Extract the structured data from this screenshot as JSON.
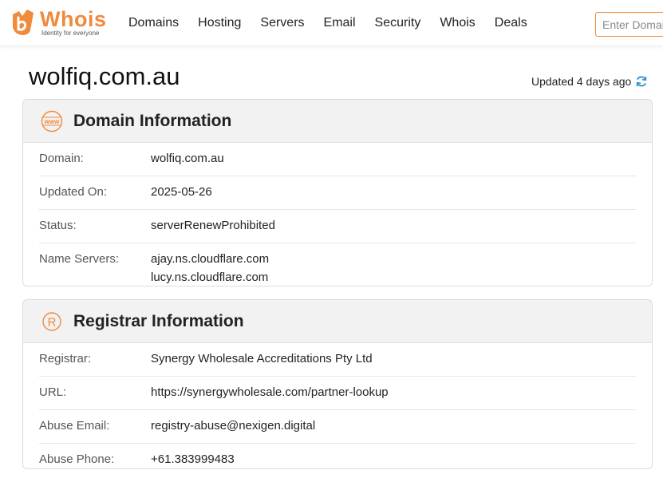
{
  "header": {
    "logo_text": "Whois",
    "logo_tagline": "Identity for everyone",
    "nav": [
      "Domains",
      "Hosting",
      "Servers",
      "Email",
      "Security",
      "Whois",
      "Deals"
    ],
    "search_placeholder": "Enter Domain or IP"
  },
  "page": {
    "title": "wolfiq.com.au",
    "updated_text": "Updated 4 days ago"
  },
  "domain_info": {
    "title": "Domain Information",
    "icon_text": "www",
    "rows": [
      {
        "label": "Domain:",
        "value": "wolfiq.com.au"
      },
      {
        "label": "Updated On:",
        "value": "2025-05-26"
      },
      {
        "label": "Status:",
        "value": "serverRenewProhibited"
      }
    ],
    "name_servers_label": "Name Servers:",
    "name_servers": [
      "ajay.ns.cloudflare.com",
      "lucy.ns.cloudflare.com"
    ]
  },
  "registrar_info": {
    "title": "Registrar Information",
    "icon_text": "R",
    "rows": [
      {
        "label": "Registrar:",
        "value": "Synergy Wholesale Accreditations Pty Ltd"
      },
      {
        "label": "URL:",
        "value": "https://synergywholesale.com/partner-lookup"
      },
      {
        "label": "Abuse Email:",
        "value": "registry-abuse@nexigen.digital"
      },
      {
        "label": "Abuse Phone:",
        "value": "+61.383999483"
      }
    ]
  },
  "colors": {
    "brand_orange": "#f08a3c",
    "refresh_blue": "#2a8fd6"
  }
}
